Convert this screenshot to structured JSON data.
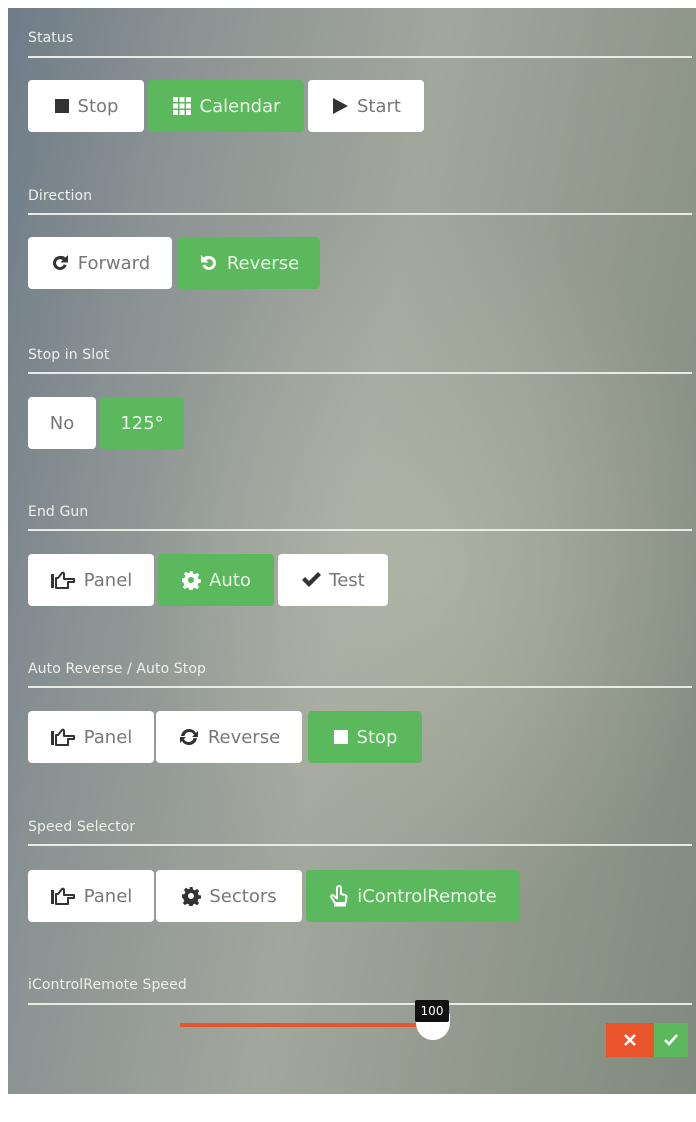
{
  "status": {
    "label": "Status",
    "buttons": [
      {
        "label": "Stop",
        "icon": "square-stop-icon",
        "active": false
      },
      {
        "label": "Calendar",
        "icon": "grid-calendar-icon",
        "active": true
      },
      {
        "label": "Start",
        "icon": "play-icon",
        "active": false
      }
    ]
  },
  "direction": {
    "label": "Direction",
    "buttons": [
      {
        "label": "Forward",
        "icon": "rotate-cw-icon",
        "active": false
      },
      {
        "label": "Reverse",
        "icon": "rotate-ccw-icon",
        "active": true
      }
    ]
  },
  "stop_in_slot": {
    "label": "Stop in Slot",
    "buttons": [
      {
        "label": "No",
        "active": false
      },
      {
        "label": "125°",
        "active": true
      }
    ]
  },
  "end_gun": {
    "label": "End Gun",
    "buttons": [
      {
        "label": "Panel",
        "icon": "hand-point-icon",
        "active": false
      },
      {
        "label": "Auto",
        "icon": "gear-icon",
        "active": true
      },
      {
        "label": "Test",
        "icon": "check-icon",
        "active": false
      }
    ]
  },
  "auto_reverse": {
    "label": "Auto Reverse / Auto Stop",
    "buttons": [
      {
        "label": "Panel",
        "icon": "hand-point-icon",
        "active": false
      },
      {
        "label": "Reverse",
        "icon": "refresh-icon",
        "active": false
      },
      {
        "label": "Stop",
        "icon": "square-stop-icon",
        "active": true
      }
    ]
  },
  "speed_selector": {
    "label": "Speed Selector",
    "buttons": [
      {
        "label": "Panel",
        "icon": "hand-point-icon",
        "active": false
      },
      {
        "label": "Sectors",
        "icon": "gear-icon",
        "active": false
      },
      {
        "label": "iControlRemote",
        "icon": "hand-touch-icon",
        "active": true
      }
    ]
  },
  "remote_speed": {
    "label": "iControlRemote Speed",
    "value": "100",
    "fraction": 1.0,
    "cancel_icon": "close-icon",
    "confirm_icon": "check-icon"
  },
  "colors": {
    "accent_green": "#5cb85c",
    "cancel_orange": "#e9542b",
    "slider_orange": "#e1562b"
  }
}
